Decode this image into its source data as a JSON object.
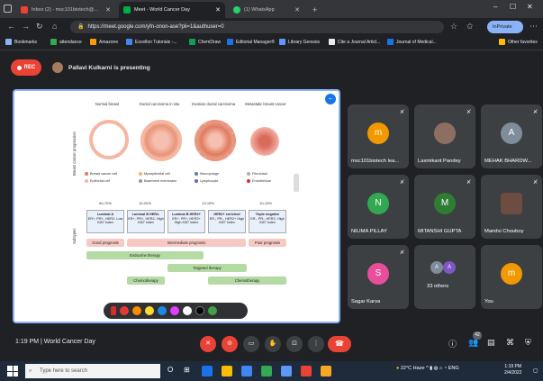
{
  "browser": {
    "tabs": [
      {
        "label": "Inbox (2) - msc101biotech@..."
      },
      {
        "label": "Meet - World Cancer Day"
      },
      {
        "label": "(1) WhatsApp"
      }
    ],
    "new_tab": "+",
    "url": "https://meet.google.com/yfn-onon-ase?pli=1&authuser=0",
    "profile": "InPrivate",
    "bookmarks": [
      {
        "label": "Bookmarks"
      },
      {
        "label": "attendance"
      },
      {
        "label": "Amazone"
      },
      {
        "label": "Excellon Tutorials -..."
      },
      {
        "label": "ChemDraw"
      },
      {
        "label": "Editorial Manager®"
      },
      {
        "label": "Library Genesis"
      },
      {
        "label": "Cite a Journal Articl..."
      },
      {
        "label": "Journal of Medical..."
      },
      {
        "label": "Other favorites"
      }
    ]
  },
  "meet": {
    "rec": "REC",
    "presenting": "Pallavi Kulkarni is presenting",
    "presenter_name": "Pallavi Kulkarni",
    "meeting_title": "World Cancer Day",
    "time": "1:19 PM",
    "participant_count": "42",
    "participants": [
      {
        "initial": "m",
        "name": "msc101biotech lea...",
        "color": "#f29900"
      },
      {
        "initial": "",
        "name": "Laxmikant Pandey",
        "color": "#8d6e63"
      },
      {
        "initial": "A",
        "name": "MEHAK BHARDW...",
        "color": "#7f8c9a"
      },
      {
        "initial": "N",
        "name": "NILIMA PILLAY",
        "color": "#33a853"
      },
      {
        "initial": "M",
        "name": "MITANSHI GUPTA",
        "color": "#2e7d32"
      },
      {
        "initial": "",
        "name": "Mandvi Chouboy",
        "color": "#6d4c41"
      },
      {
        "initial": "S",
        "name": "Sagar Karsa",
        "color": "#e94e9a"
      },
      {
        "initial": "A",
        "name": "33 others",
        "color": "#7f8c9a"
      },
      {
        "initial": "m",
        "name": "You",
        "color": "#f29900"
      }
    ]
  },
  "slide": {
    "side_label_top": "Breast cancer progression",
    "side_label_bottom": "Subtypes",
    "stages": [
      "Normal breast",
      "Ductal carcinoma in situ",
      "Invasive ductal carcinoma",
      "Metastatic breast cancer"
    ],
    "legend": [
      "Breast cancer cell",
      "Myoepithelial cell",
      "Macrophage",
      "Fibroblast",
      "Epithelial cell",
      "Basement membrane",
      "Lymphocyte",
      "Endothelium"
    ],
    "percentages": [
      "60-70%",
      "10-20%",
      "13-15%",
      "10-15%"
    ],
    "subtypes": [
      {
        "title": "Luminal A",
        "desc": "ER+, PR+, HER2- Low Ki67 index"
      },
      {
        "title": "Luminal B HER2-",
        "desc": "ER+, PR+, HER2- High Ki67 index"
      },
      {
        "title": "Luminal B HER2+",
        "desc": "ER+, PR+, HER2+ High Ki67 index"
      },
      {
        "title": "HER2+ enriched",
        "desc": "ER-, PR-, HER2+ High Ki67 index"
      },
      {
        "title": "Triple negative",
        "desc": "ER-, PR-, HER2- High Ki67 index"
      }
    ],
    "prognosis": [
      "Good prognosis",
      "Intermediate prognosis",
      "Poor prognosis"
    ],
    "therapies": [
      "Endocrine therapy",
      "Targeted therapy",
      "Chemotherapy",
      "Chemotherapy"
    ]
  },
  "taskbar": {
    "search_placeholder": "Type here to search",
    "weather": "22°C Haze",
    "lang": "ENG",
    "time": "1:19 PM",
    "date": "2/4/2022"
  }
}
